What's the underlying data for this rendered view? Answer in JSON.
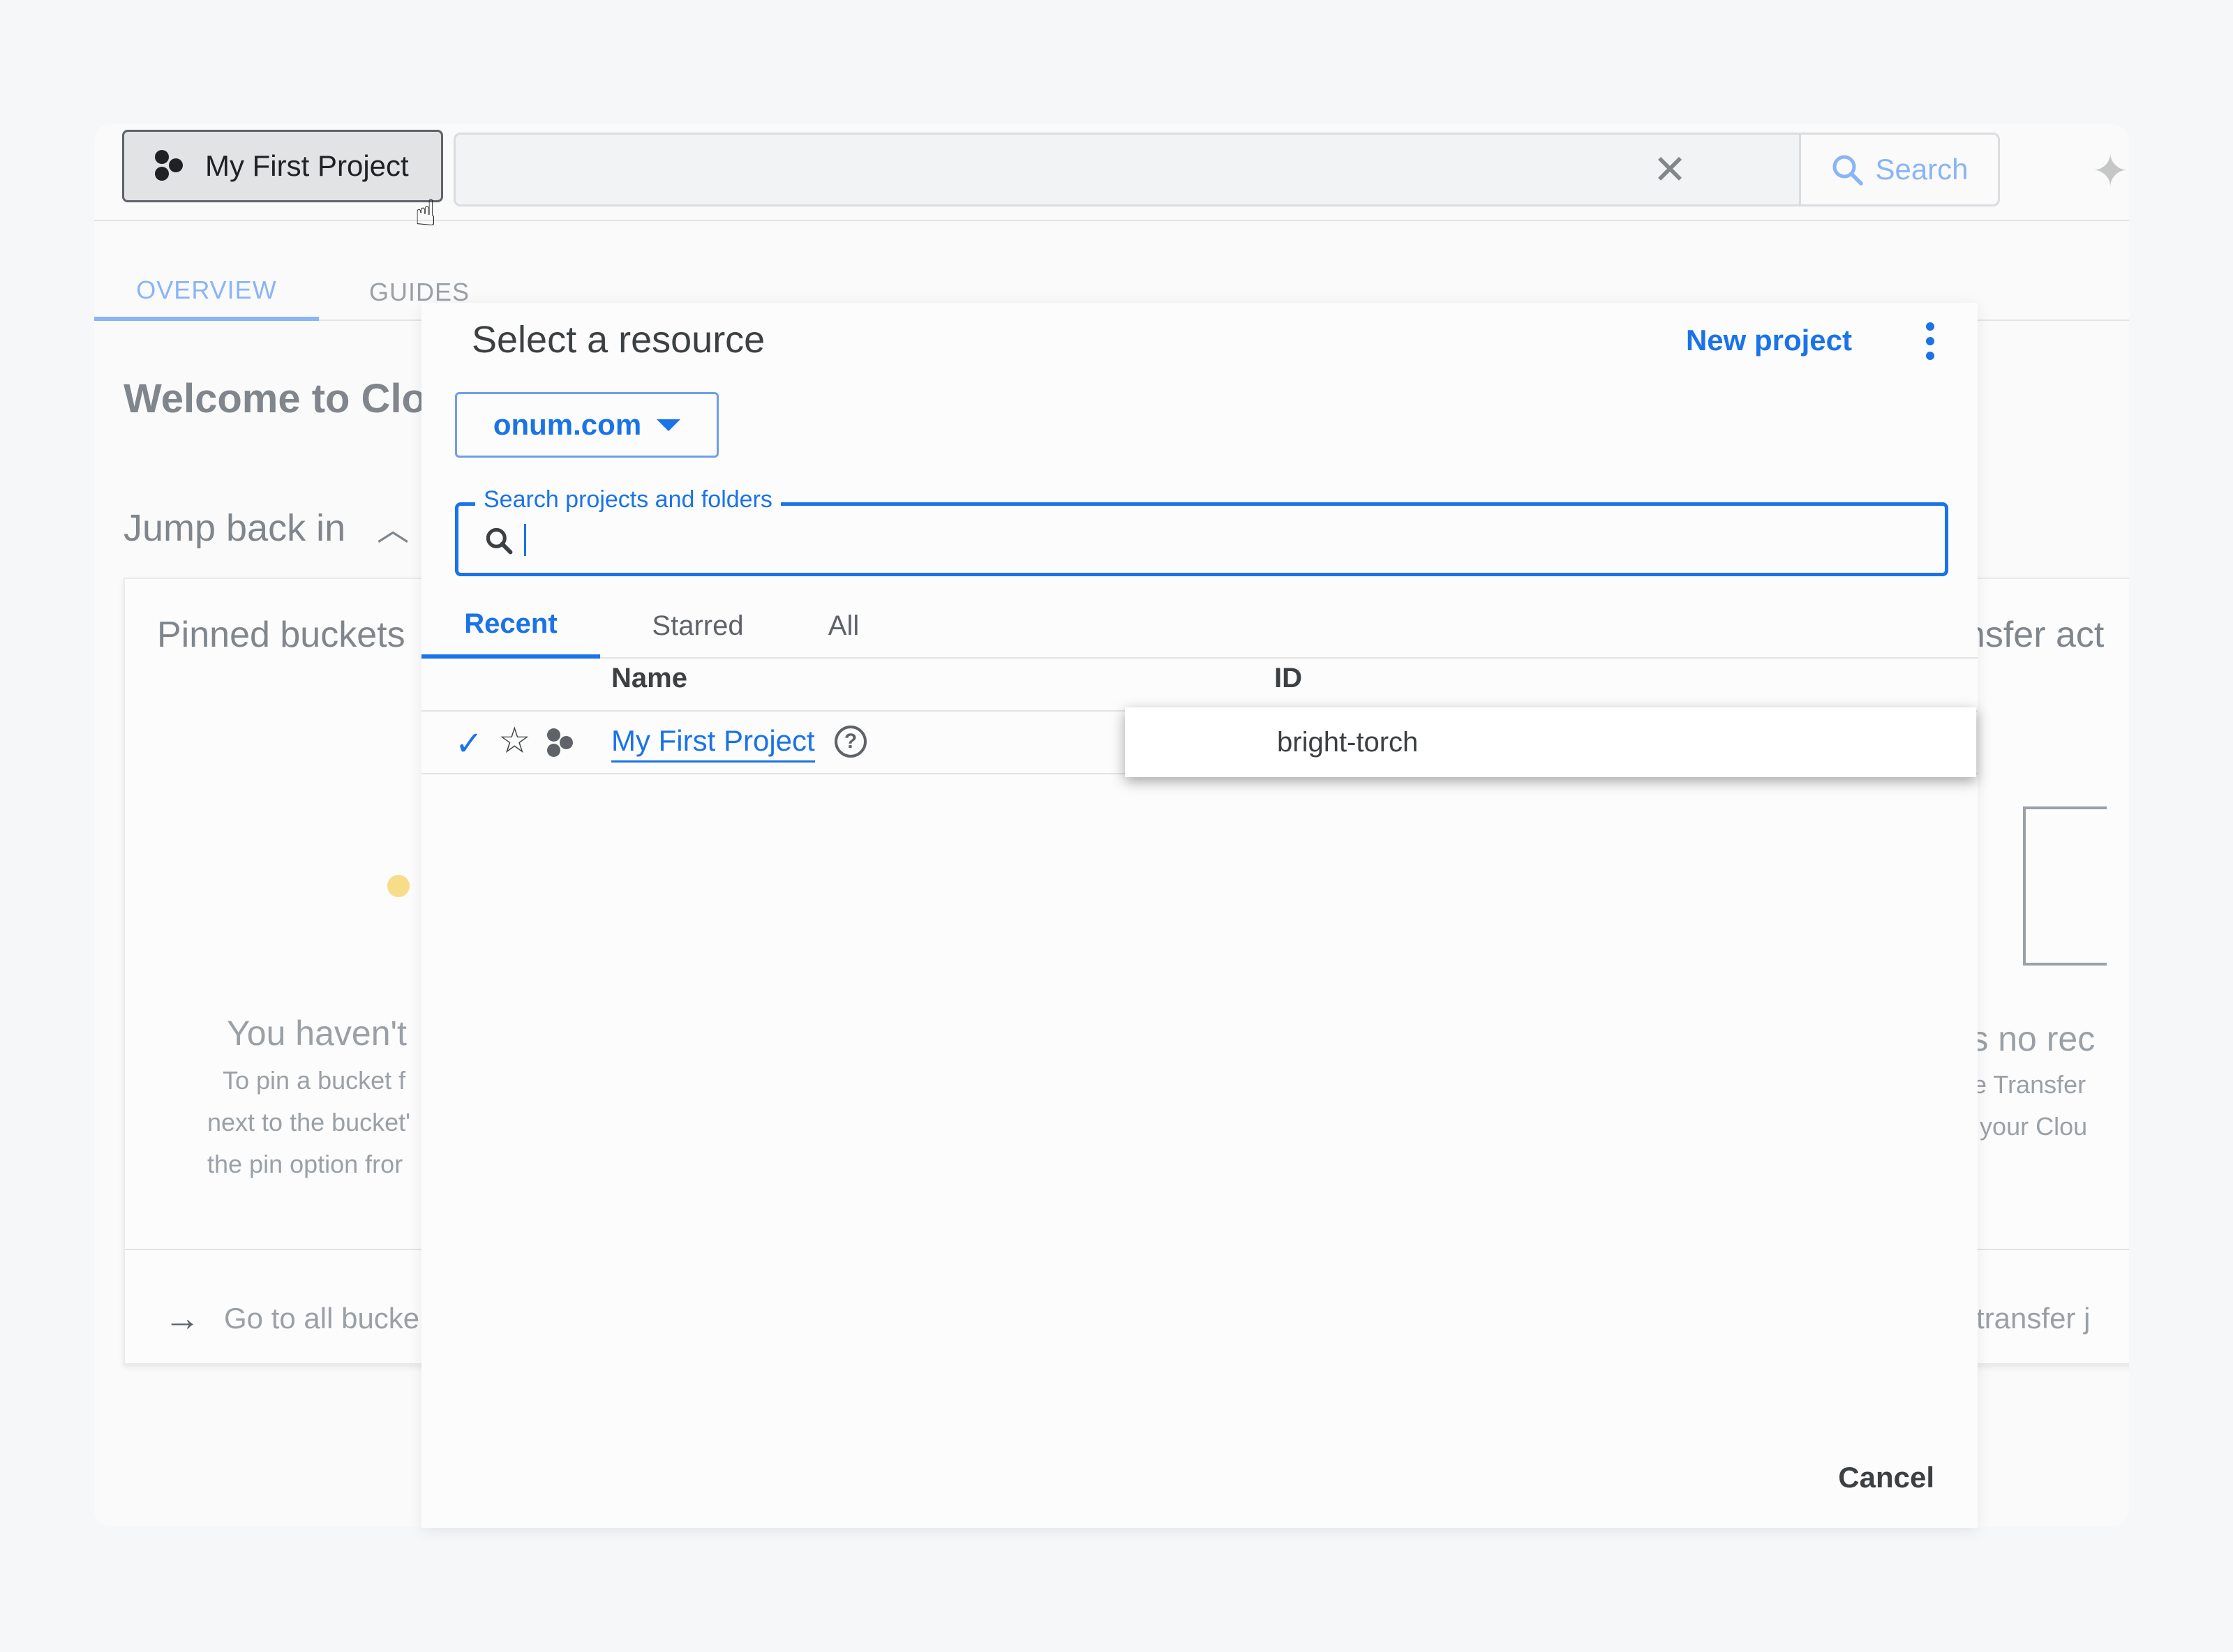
{
  "header": {
    "project_label": "My First Project",
    "search_label": "Search",
    "clear_icon": "close-icon",
    "search_icon": "search-icon",
    "gemini_icon": "sparkle-icon"
  },
  "background": {
    "tabs": [
      {
        "label": "OVERVIEW",
        "active": true
      },
      {
        "label": "GUIDES",
        "active": false
      }
    ],
    "welcome": "Welcome to Clou",
    "jump_back": "Jump back in",
    "pinned_title": "Pinned buckets",
    "empty_title": "You haven't",
    "empty_lines": [
      "To pin a bucket f",
      "next to the bucket'",
      "the pin option fror"
    ],
    "go_link": "Go to all bucke",
    "right_title": "ansfer act",
    "right_empty": "e's no rec",
    "right_lines": [
      "age Transfer",
      "en your Clou"
    ],
    "right_link": "a transfer j"
  },
  "dialog": {
    "title": "Select a resource",
    "new_project": "New project",
    "org": "onum.com",
    "search_label": "Search projects and folders",
    "tabs": [
      "Recent",
      "Starred",
      "All"
    ],
    "active_tab": "Recent",
    "columns": {
      "name": "Name",
      "id": "ID"
    },
    "rows": [
      {
        "name": "My First Project",
        "id": "bright-torch",
        "selected": true,
        "starred": false
      }
    ],
    "cancel": "Cancel"
  },
  "colors": {
    "accent": "#1a73e8",
    "muted_accent": "#8ab4f8",
    "text": "#3c4043"
  }
}
